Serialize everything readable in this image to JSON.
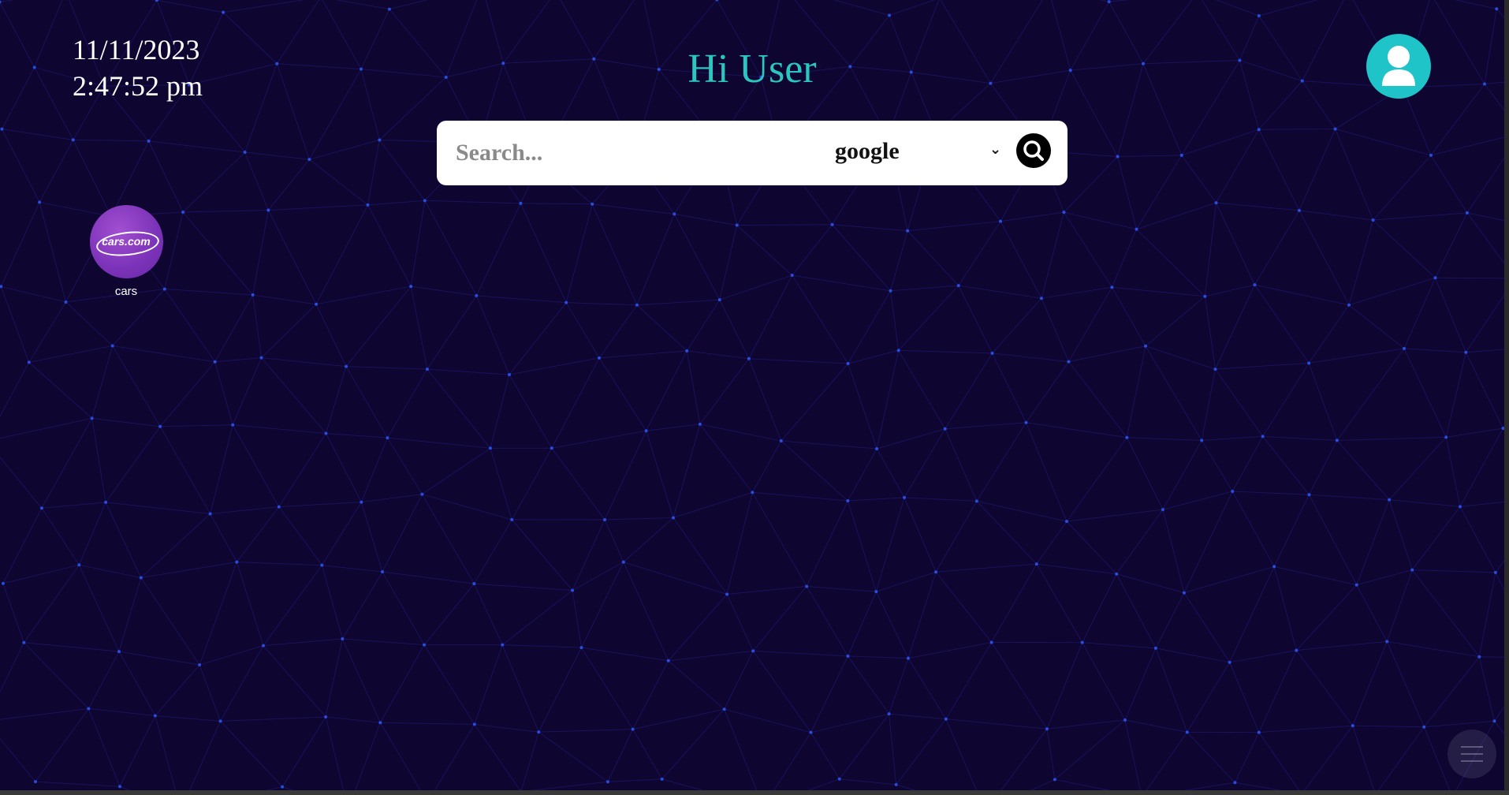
{
  "clock": {
    "date": "11/11/2023",
    "time": "2:47:52 pm"
  },
  "header": {
    "greeting": "Hi User",
    "avatar_icon": "user-avatar-icon"
  },
  "search": {
    "placeholder": "Search...",
    "value": "",
    "engine_selected": "google",
    "dropdown_icon": "chevron-down-icon",
    "button_icon": "search-icon"
  },
  "shortcuts": [
    {
      "label": "cars",
      "logo_text": "cars.com",
      "icon": "cars-com-logo"
    }
  ],
  "menu": {
    "icon": "hamburger-menu-icon"
  },
  "colors": {
    "background": "#0e0530",
    "mesh_line": "#2a2fae",
    "mesh_dot": "#2f5bff",
    "greeting": "#2cc6c0",
    "avatar": "#1fc4c9",
    "shortcut": "#7b32b8"
  }
}
